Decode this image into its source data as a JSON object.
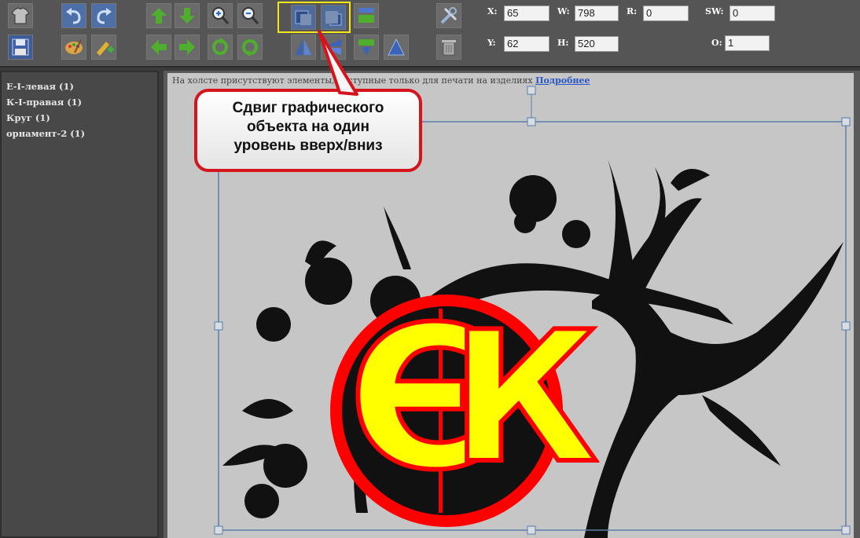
{
  "toolbar": {
    "buttons_row1": [
      "tshirt-icon",
      "undo-icon",
      "redo-icon",
      "move-up-icon",
      "move-down-icon",
      "zoom-in-icon",
      "zoom-out-icon",
      "layer-up-icon",
      "layer-down-icon",
      "align-icon",
      "tools-icon"
    ],
    "buttons_row2": [
      "save-icon",
      "palette-icon",
      "add-text-icon",
      "move-left-icon",
      "move-right-icon",
      "rotate-left-icon",
      "rotate-right-icon",
      "flip-h-icon",
      "flip-v-icon",
      "flip-icon",
      "mirror-icon",
      "trash-icon"
    ],
    "fields": {
      "x_label": "X:",
      "x_value": "65",
      "w_label": "W:",
      "w_value": "798",
      "r_label": "R:",
      "r_value": "0",
      "sw_label": "SW:",
      "sw_value": "0",
      "y_label": "Y:",
      "y_value": "62",
      "h_label": "H:",
      "h_value": "520",
      "o_label": "O:",
      "o_value": "1"
    }
  },
  "sidebar": {
    "layers": [
      "Е-I-левая (1)",
      "К-I-правая (1)",
      "Круг (1)",
      "орнамент-2 (1)"
    ]
  },
  "canvas": {
    "notice_text": "На холсте присутствуют элементы, доступные только для печати на изделиях",
    "notice_link": "Подробнее",
    "monogram_left": "Є",
    "monogram_right": "К"
  },
  "callout": {
    "line1": "Сдвиг графического",
    "line2": "объекта на один",
    "line3": "уровень вверх/вниз"
  },
  "colors": {
    "accent": "#f5e61a",
    "monogram_fill": "#ffff00",
    "monogram_ring": "#ff0000",
    "callout_border": "#d6141c"
  }
}
